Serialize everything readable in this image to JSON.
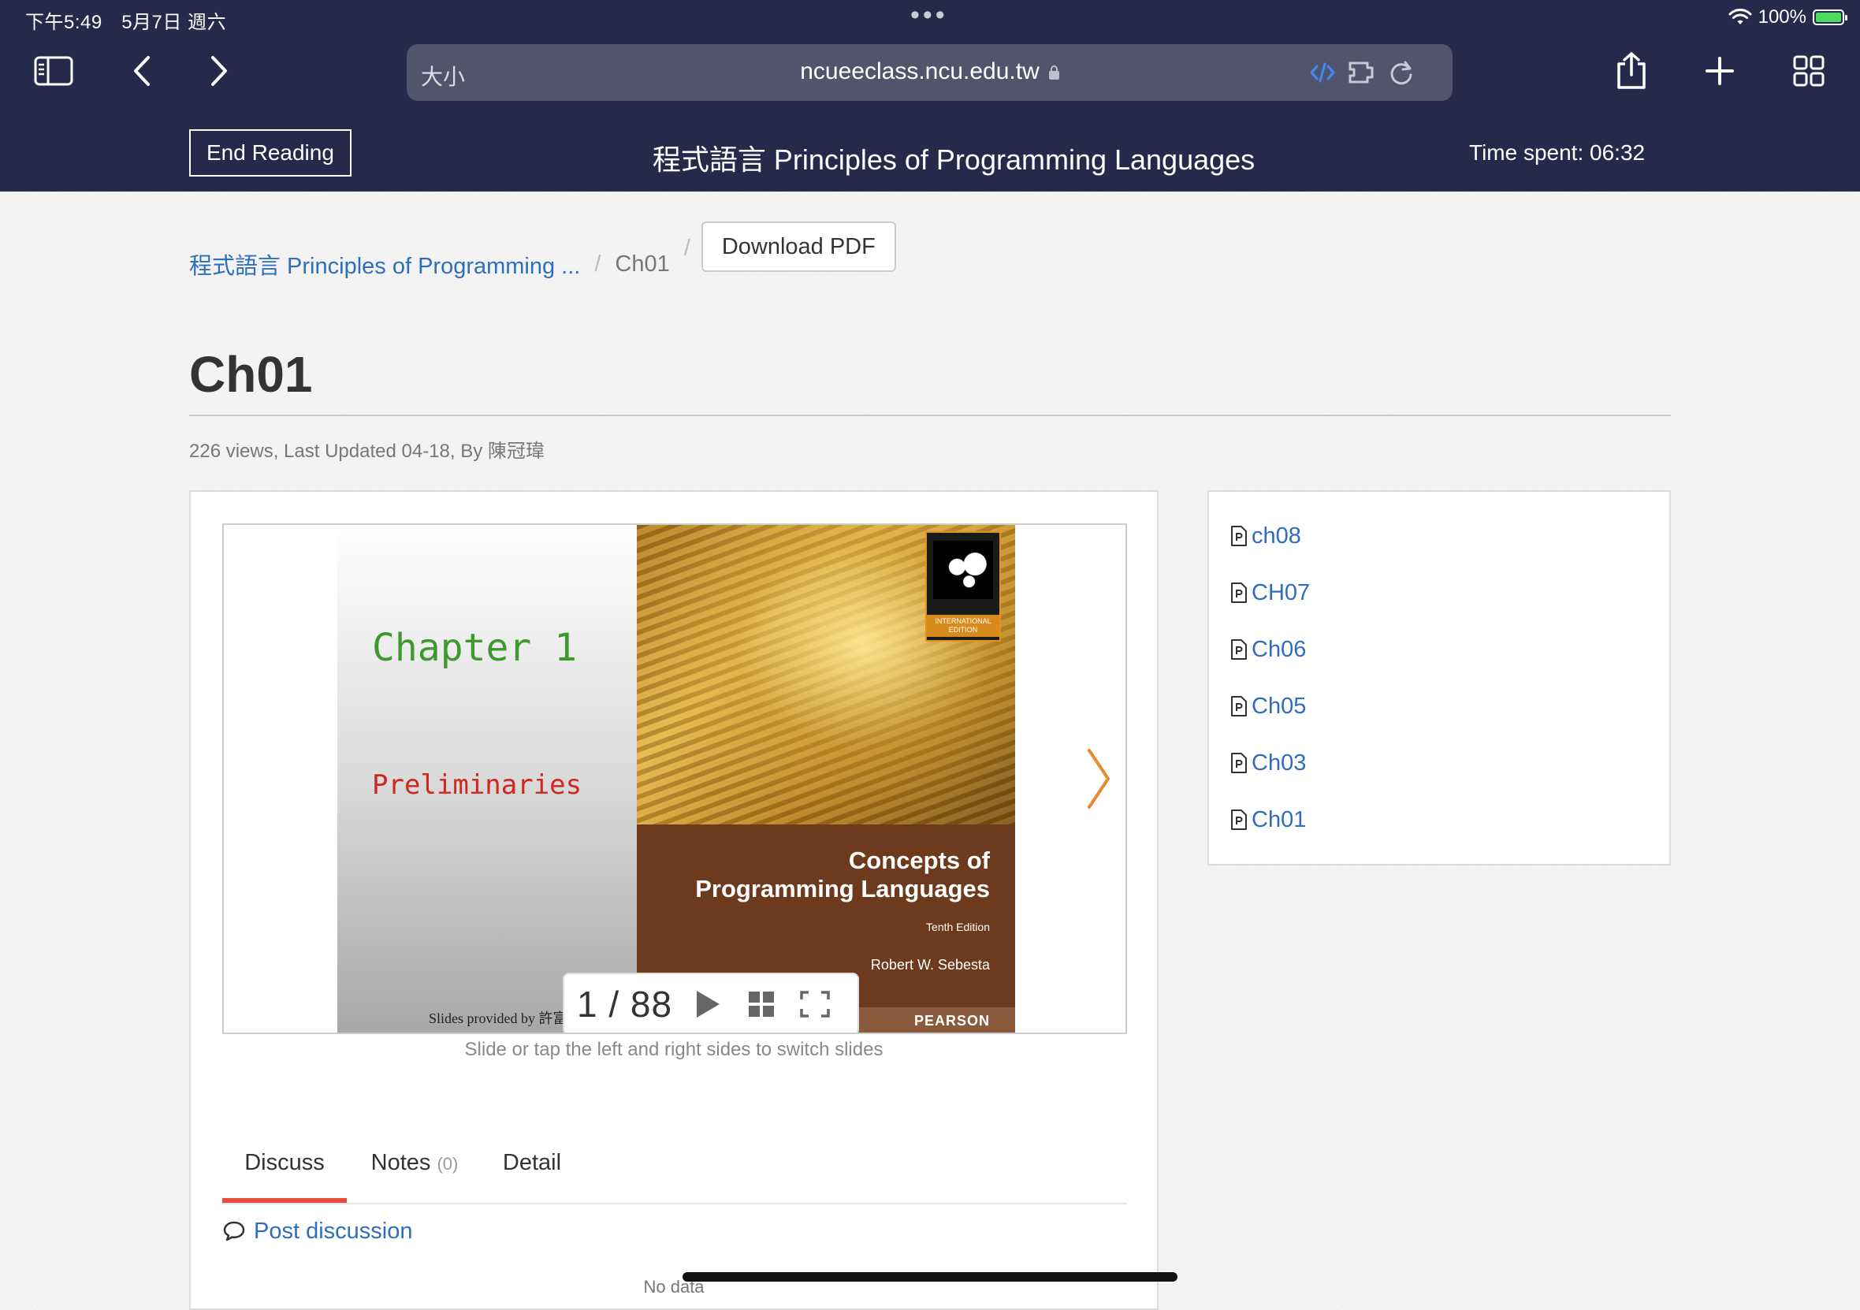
{
  "status_bar": {
    "time_date": "下午5:49　5月7日 週六",
    "battery": "100%"
  },
  "browser": {
    "text_size_label": "大小",
    "url": "ncueeclass.ncu.edu.tw"
  },
  "reader_bar": {
    "end_reading_label": "End Reading",
    "title": "程式語言 Principles of Programming Languages",
    "time_spent": "Time spent: 06:32"
  },
  "breadcrumb": {
    "course": "程式語言 Principles of Programming ...",
    "current": "Ch01",
    "separator": "/",
    "download_label": "Download PDF"
  },
  "page": {
    "title": "Ch01",
    "meta": "226 views, Last Updated 04-18, By 陳冠瑋"
  },
  "slide": {
    "chapter": "Chapter 1",
    "subtitle": "Preliminaries",
    "credit": "Slides provided by 許富皓教授",
    "book_title_line1": "Concepts of",
    "book_title_line2": "Programming Languages",
    "edition": "Tenth Edition",
    "author": "Robert W. Sebesta",
    "publisher": "PEARSON",
    "badge": "INTERNATIONAL EDITION",
    "page_count": "1 / 88",
    "current_page": 1,
    "total_pages": 88,
    "hint": "Slide or tap the left and right sides to switch slides"
  },
  "tabs": [
    {
      "label": "Discuss",
      "count": "",
      "active": true
    },
    {
      "label": "Notes",
      "count": "(0)",
      "active": false
    },
    {
      "label": "Detail",
      "count": "",
      "active": false
    }
  ],
  "discussion": {
    "post_label": "Post discussion",
    "empty_label": "No data"
  },
  "sidebar": {
    "items": [
      {
        "label": "ch08"
      },
      {
        "label": "CH07"
      },
      {
        "label": "Ch06"
      },
      {
        "label": "Ch05"
      },
      {
        "label": "Ch03"
      },
      {
        "label": "Ch01"
      }
    ]
  },
  "colors": {
    "chrome_bg": "#262a4a",
    "link": "#2f6ebd",
    "tab_active": "#e74c3c",
    "next_arrow": "#e8892c"
  }
}
